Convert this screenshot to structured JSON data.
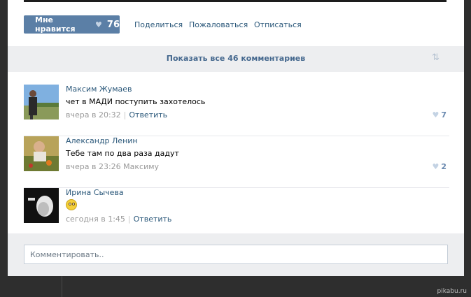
{
  "post": {
    "like_label": "Мне нравится",
    "like_count": "76",
    "share_label": "Поделиться",
    "report_label": "Пожаловаться",
    "unsubscribe_label": "Отписаться"
  },
  "comments_header": {
    "show_all_label": "Показать все 46 комментариев",
    "sort_icon": "sort-arrows-icon"
  },
  "comments": [
    {
      "author": "Максим Жумаев",
      "text": "чет в МАДИ поступить захотелось",
      "time": "вчера в 20:32",
      "reply_label": "Ответить",
      "likes": "7"
    },
    {
      "author": "Александр Ленин",
      "text": "Тебе там по два раза дадут",
      "time": "вчера в 23:26 Максиму",
      "likes": "2"
    },
    {
      "author": "Ирина Сычева",
      "emoji_icon": "rolling-eyes-emoji-icon",
      "time": "сегодня в 1:45",
      "reply_label": "Ответить"
    }
  ],
  "comment_input": {
    "placeholder": "Комментировать.."
  },
  "watermark": "pikabu.ru",
  "colors": {
    "accent": "#5b7fa6",
    "link": "#2b587a",
    "bar_background": "#edeef0"
  }
}
